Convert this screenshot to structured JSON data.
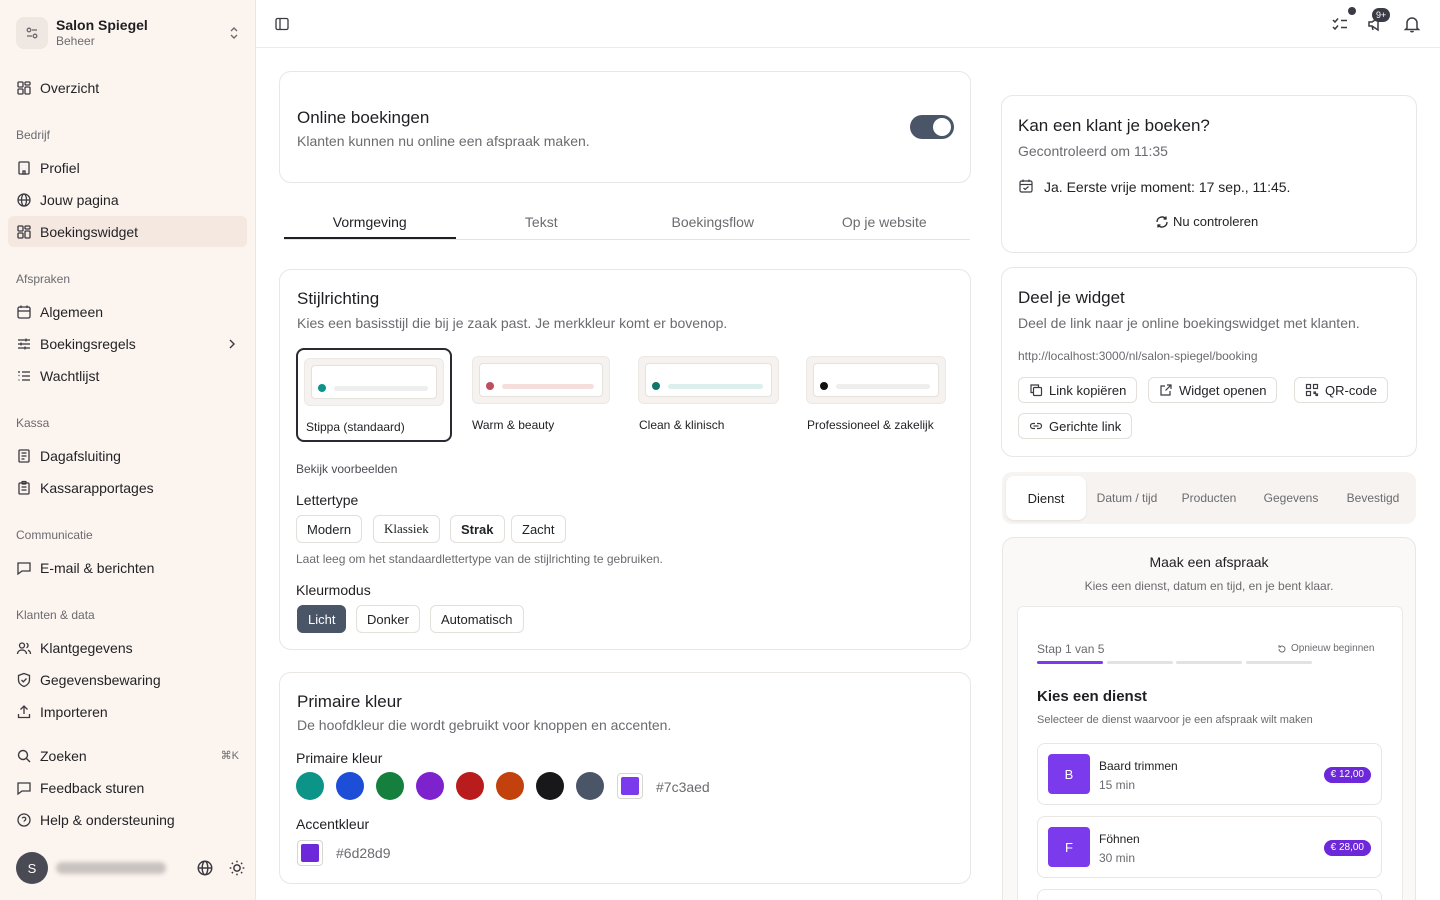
{
  "sidebar": {
    "org_name": "Salon Spiegel",
    "org_sub": "Beheer",
    "overview": "Overzicht",
    "groups": {
      "bedrijf": "Bedrijf",
      "afspraken": "Afspraken",
      "kassa": "Kassa",
      "communicatie": "Communicatie",
      "klanten": "Klanten & data"
    },
    "items": {
      "profiel": "Profiel",
      "jouw_pagina": "Jouw pagina",
      "boekingswidget": "Boekingswidget",
      "algemeen": "Algemeen",
      "boekingsregels": "Boekingsregels",
      "wachtlijst": "Wachtlijst",
      "dagafsluiting": "Dagafsluiting",
      "kassarapportages": "Kassarapportages",
      "email": "E-mail & berichten",
      "klantgegevens": "Klantgegevens",
      "gegevensbewaring": "Gegevensbewaring",
      "importeren": "Importeren",
      "zoeken": "Zoeken",
      "zoeken_shortcut": "⌘K",
      "feedback": "Feedback sturen",
      "help": "Help & ondersteuning"
    },
    "avatar_initial": "S"
  },
  "header": {
    "badge": "9+"
  },
  "online": {
    "title": "Online boekingen",
    "desc": "Klanten kunnen nu online een afspraak maken.",
    "enabled": true
  },
  "tabs": [
    "Vormgeving",
    "Tekst",
    "Boekingsflow",
    "Op je website"
  ],
  "stijl": {
    "title": "Stijlrichting",
    "desc": "Kies een basisstijl die bij je zaak past. Je merkkleur komt er bovenop.",
    "options": [
      {
        "label": "Stippa (standaard)",
        "dot": "#0d9488",
        "bar": "#eeeeee"
      },
      {
        "label": "Warm & beauty",
        "dot": "#be4d5e",
        "bar": "#f6dedd"
      },
      {
        "label": "Clean & klinisch",
        "dot": "#0f766e",
        "bar": "#dcefec"
      },
      {
        "label": "Professioneel & zakelijk",
        "dot": "#111111",
        "bar": "#eeeeee"
      }
    ],
    "voorbeelden": "Bekijk voorbeelden",
    "lettertype_label": "Lettertype",
    "lettertypes": [
      "Modern",
      "Klassiek",
      "Strak",
      "Zacht"
    ],
    "lettertype_hint": "Laat leeg om het standaardlettertype van de stijlrichting te gebruiken.",
    "kleurmodus_label": "Kleurmodus",
    "kleurmodi": [
      "Licht",
      "Donker",
      "Automatisch"
    ]
  },
  "primair": {
    "title": "Primaire kleur",
    "desc": "De hoofdkleur die wordt gebruikt voor knoppen en accenten.",
    "label": "Primaire kleur",
    "swatches": [
      "#0d9488",
      "#1d4ed8",
      "#15803d",
      "#7e22ce",
      "#b91c1c",
      "#c2410c",
      "#18181b",
      "#4a5568"
    ],
    "value": "#7c3aed",
    "accent_label": "Accentkleur",
    "accent_value": "#6d28d9"
  },
  "check": {
    "title": "Kan een klant je boeken?",
    "sub": "Gecontroleerd om 11:35",
    "result": "Ja. Eerste vrije moment: 17 sep., 11:45.",
    "action": "Nu controleren"
  },
  "deel": {
    "title": "Deel je widget",
    "desc": "Deel de link naar je online boekingswidget met klanten.",
    "url": "http://localhost:3000/nl/salon-spiegel/booking",
    "buttons": {
      "copy": "Link kopiëren",
      "open": "Widget openen",
      "qr": "QR-code",
      "targeted": "Gerichte link"
    }
  },
  "preview": {
    "steps": [
      "Dienst",
      "Datum / tijd",
      "Producten",
      "Gegevens",
      "Bevestigd"
    ],
    "title": "Maak een afspraak",
    "sub": "Kies een dienst, datum en tijd, en je bent klaar.",
    "step_text": "Stap 1 van 5",
    "restart": "Opnieuw beginnen",
    "progress_step": 1,
    "progress_total": 5,
    "section_title": "Kies een dienst",
    "section_desc": "Selecteer de dienst waarvoor je een afspraak wilt maken",
    "services": [
      {
        "letter": "B",
        "name": "Baard trimmen",
        "duration": "15 min",
        "price": "€ 12,00"
      },
      {
        "letter": "F",
        "name": "Föhnen",
        "duration": "30 min",
        "price": "€ 28,00"
      }
    ],
    "accent": "#7c3aed"
  }
}
